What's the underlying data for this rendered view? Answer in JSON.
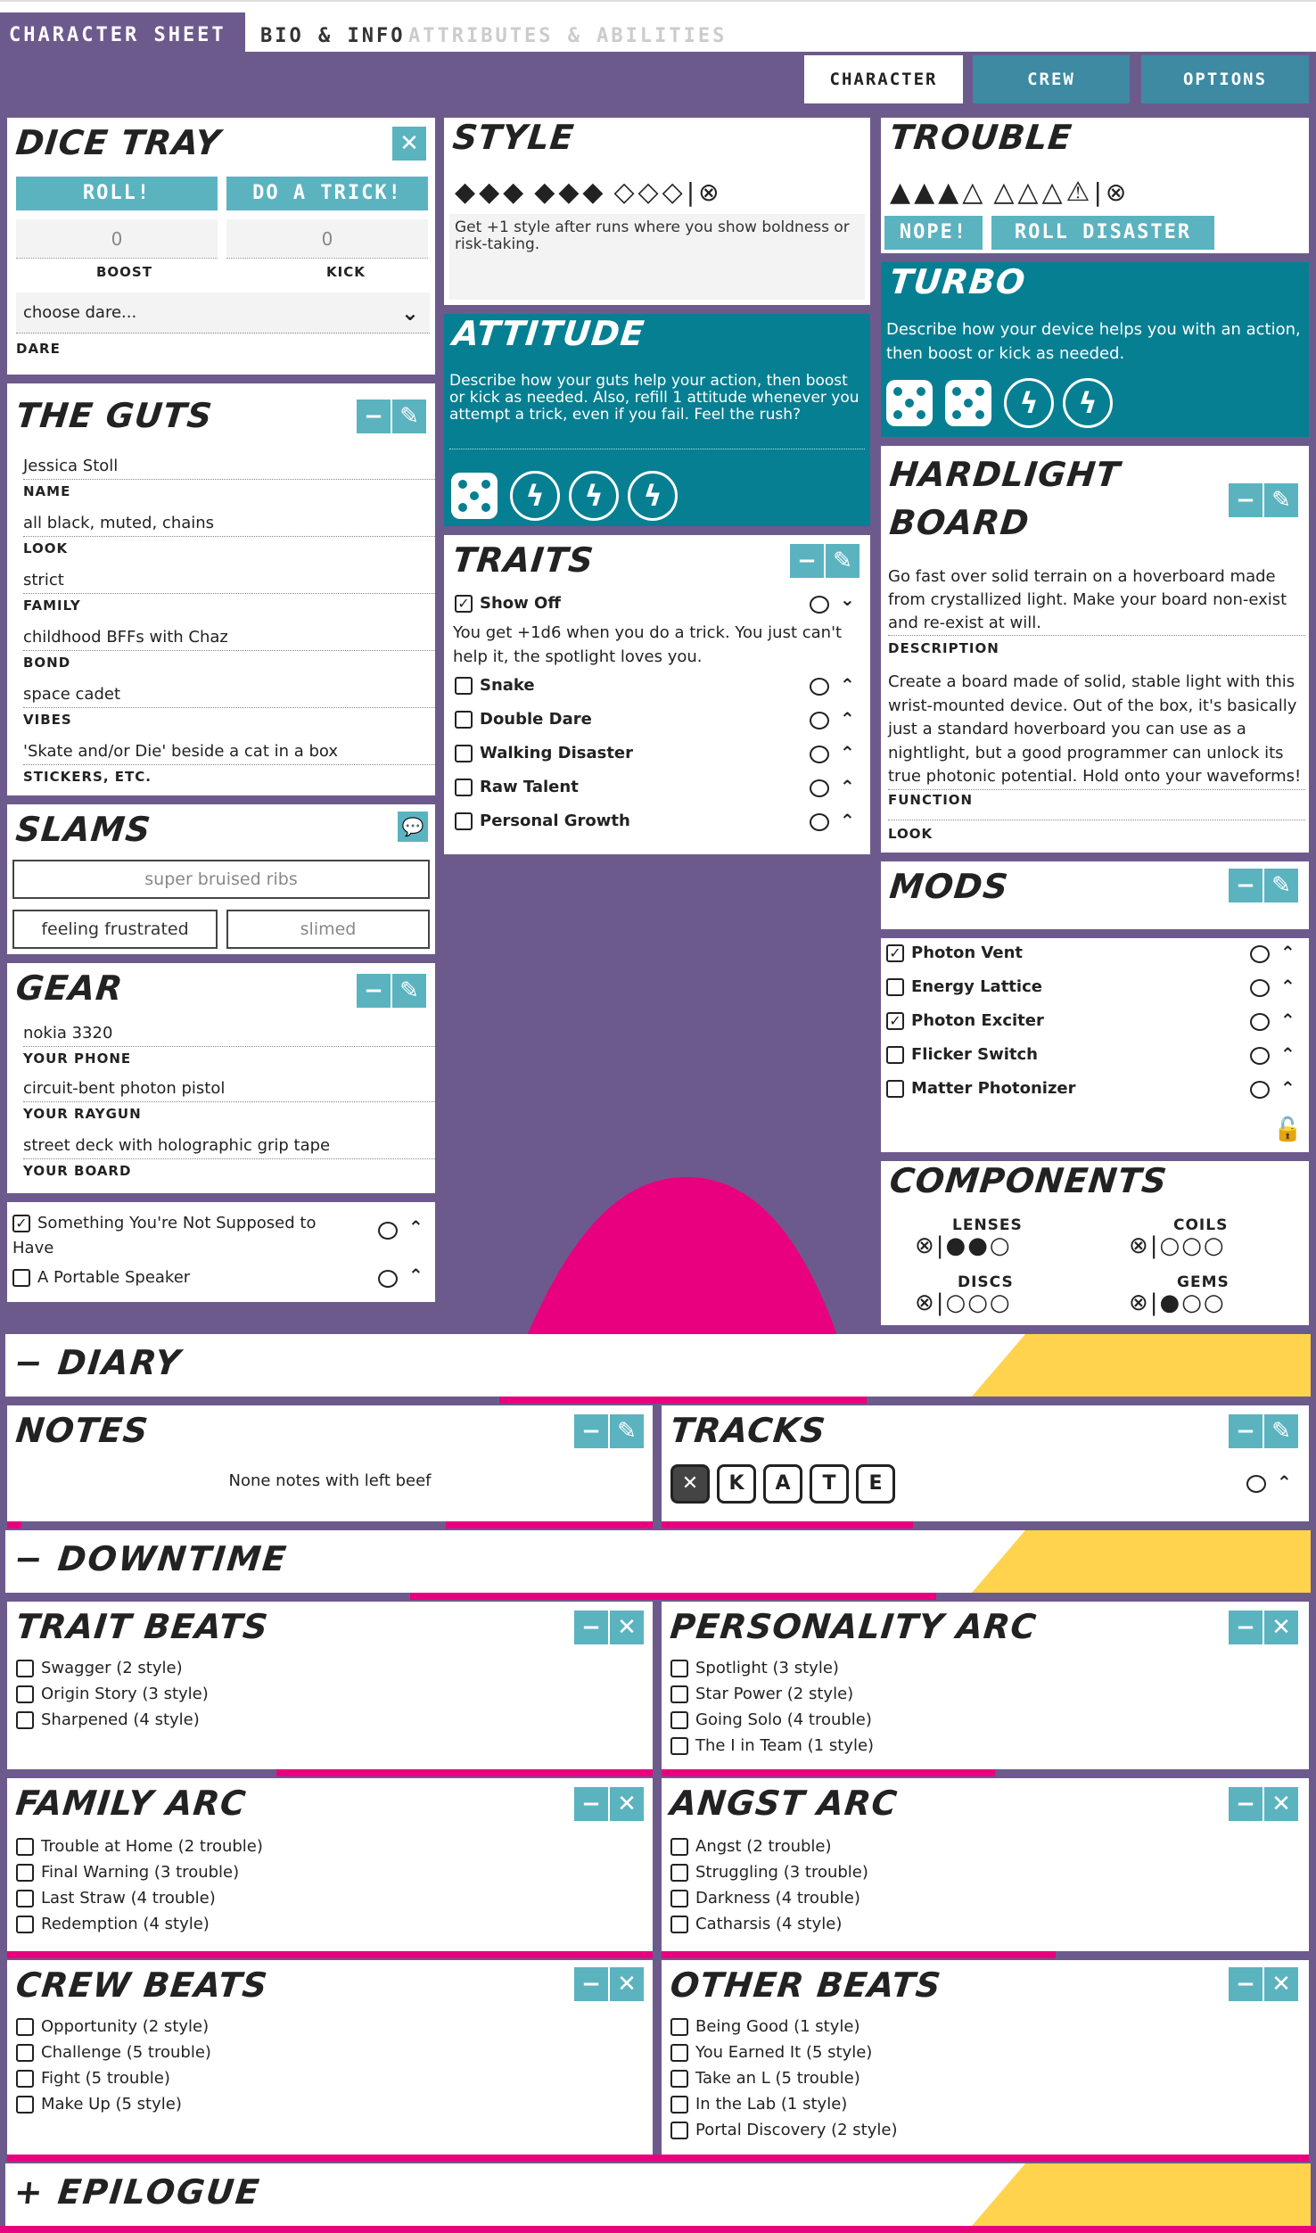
{
  "tabs": {
    "active": "CHARACTER SHEET",
    "bio": "BIO & INFO",
    "attrs": "ATTRIBUTES & ABILITIES"
  },
  "nav": {
    "character": "CHARACTER",
    "crew": "CREW",
    "options": "OPTIONS"
  },
  "dice_tray": {
    "title": "DICE TRAY",
    "roll": "ROLL!",
    "trick": "DO A TRICK!",
    "boost_value": "0",
    "kick_value": "0",
    "boost_label": "BOOST",
    "kick_label": "KICK",
    "dare_select": "choose dare...",
    "dare_label": "DARE"
  },
  "style": {
    "title": "STYLE",
    "filled": 6,
    "total": 9,
    "note": "Get +1 style after runs where you show boldness or risk-taking."
  },
  "trouble": {
    "title": "TROUBLE",
    "filled": 3,
    "total": 8,
    "nope": "NOPE!",
    "disaster": "ROLL DISASTER"
  },
  "turbo": {
    "title": "TURBO",
    "text": "Describe how your device helps you with an action, then boost or kick as needed."
  },
  "attitude": {
    "title": "ATTITUDE",
    "text": "Describe how your guts help your action, then boost or kick as needed. Also, refill 1 attitude whenever you attempt a trick, even if you fail. Feel the rush?"
  },
  "guts": {
    "title": "THE GUTS",
    "fields": [
      {
        "value": "Jessica Stoll",
        "label": "NAME"
      },
      {
        "value": "all black, muted, chains",
        "label": "LOOK"
      },
      {
        "value": "strict",
        "label": "FAMILY"
      },
      {
        "value": "childhood BFFs with Chaz",
        "label": "BOND"
      },
      {
        "value": "space cadet",
        "label": "VIBES"
      },
      {
        "value": "'Skate and/or Die' beside a cat in a box",
        "label": "STICKERS, ETC."
      }
    ]
  },
  "traits": {
    "title": "TRAITS",
    "items": [
      {
        "label": "Show Off",
        "checked": true,
        "desc": "You get +1d6 when you do a trick. You just can't help it, the spotlight loves you."
      },
      {
        "label": "Snake",
        "checked": false
      },
      {
        "label": "Double Dare",
        "checked": false
      },
      {
        "label": "Walking Disaster",
        "checked": false
      },
      {
        "label": "Raw Talent",
        "checked": false
      },
      {
        "label": "Personal Growth",
        "checked": false
      }
    ]
  },
  "hardlight": {
    "title_line1": "HARDLIGHT",
    "title_line2": "BOARD",
    "description": "Go fast over solid terrain on a hoverboard made from crystallized light. Make your board non-exist and re-exist at will.",
    "description_label": "DESCRIPTION",
    "function": "Create a board made of solid, stable light with this wrist-mounted device. Out of the box, it's basically just a standard hoverboard you can use as a nightlight, but a good programmer can unlock its true photonic potential. Hold onto your waveforms!",
    "function_label": "FUNCTION",
    "look_label": "LOOK"
  },
  "slams": {
    "title": "SLAMS",
    "items": [
      "super bruised ribs",
      "feeling frustrated",
      "slimed"
    ]
  },
  "gear": {
    "title": "GEAR",
    "fields": [
      {
        "value": "nokia 3320",
        "label": "YOUR PHONE"
      },
      {
        "value": "circuit-bent photon pistol",
        "label": "YOUR RAYGUN"
      },
      {
        "value": "street deck with holographic grip tape",
        "label": "YOUR BOARD"
      }
    ],
    "items": [
      {
        "label": "Something You're Not Supposed to Have",
        "checked": true
      },
      {
        "label": "A Portable Speaker",
        "checked": false
      }
    ]
  },
  "mods": {
    "title": "MODS",
    "items": [
      {
        "label": "Photon Vent",
        "checked": true
      },
      {
        "label": "Energy Lattice",
        "checked": false
      },
      {
        "label": "Photon Exciter",
        "checked": true
      },
      {
        "label": "Flicker Switch",
        "checked": false
      },
      {
        "label": "Matter Photonizer",
        "checked": false
      }
    ]
  },
  "components": {
    "title": "COMPONENTS",
    "lenses": "LENSES",
    "coils": "COILS",
    "discs": "DISCS",
    "gems": "GEMS",
    "lenses_filled": 2,
    "coils_filled": 0,
    "discs_filled": 0,
    "gems_filled": 1
  },
  "diary": {
    "title": "− DIARY"
  },
  "notes": {
    "title": "NOTES",
    "text": "None notes with left beef"
  },
  "tracks": {
    "title": "TRACKS",
    "letters": [
      "✕",
      "K",
      "A",
      "T",
      "E"
    ]
  },
  "downtime": {
    "title": "− DOWNTIME"
  },
  "trait_beats": {
    "title": "TRAIT BEATS",
    "items": [
      "Swagger (2 style)",
      "Origin Story (3 style)",
      "Sharpened (4 style)"
    ]
  },
  "personality_arc": {
    "title": "PERSONALITY ARC",
    "items": [
      "Spotlight (3 style)",
      "Star Power (2 style)",
      "Going Solo (4 trouble)",
      "The I in Team (1 style)"
    ]
  },
  "family_arc": {
    "title": "FAMILY ARC",
    "items": [
      "Trouble at Home (2 trouble)",
      "Final Warning (3 trouble)",
      "Last Straw (4 trouble)",
      "Redemption (4 style)"
    ]
  },
  "angst_arc": {
    "title": "ANGST ARC",
    "items": [
      "Angst (2 trouble)",
      "Struggling (3 trouble)",
      "Darkness (4 trouble)",
      "Catharsis (4 style)"
    ]
  },
  "crew_beats": {
    "title": "CREW BEATS",
    "items": [
      "Opportunity (2 style)",
      "Challenge (5 trouble)",
      "Fight (5 trouble)",
      "Make Up (5 style)"
    ]
  },
  "other_beats": {
    "title": "OTHER BEATS",
    "items": [
      "Being Good (1 style)",
      "You Earned It (5 style)",
      "Take an L (5 trouble)",
      "In the Lab (1 style)",
      "Portal Discovery (2 style)"
    ]
  },
  "epilogue": {
    "title": "+ EPILOGUE"
  },
  "colors": {
    "purple": "#6d5a8d",
    "teal": "#067f92",
    "light_teal": "#5bb3c0",
    "pink": "#e8007e",
    "yellow": "#ffd34e"
  }
}
